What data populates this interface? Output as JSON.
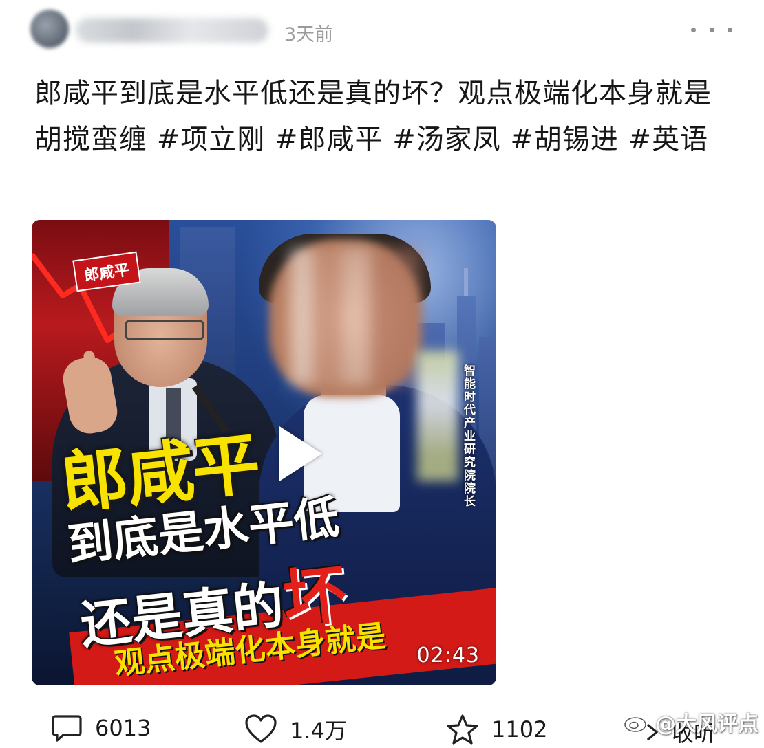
{
  "header": {
    "author_name": "",
    "time_ago": "3天前",
    "more_icon": "more-dots-icon"
  },
  "post": {
    "text_plain": "郎咸平到底是水平低还是真的坏？观点极端化本身就是胡搅蛮缠",
    "hashtags": [
      "#项立刚",
      "#郎咸平",
      "#汤家凤",
      "#胡锡进",
      "#英语"
    ]
  },
  "video": {
    "name_tag": "郎咸平",
    "headline_1": "郎咸平",
    "headline_2": "到底是水平低",
    "headline_3_prefix": "还是真的",
    "headline_3_accent": "坏",
    "headline_4": "观点极端化本身就是",
    "side_caption": "智能时代产业研究院院长",
    "duration": "02:43",
    "colors": {
      "headline_yellow": "#f7e200",
      "accent_red": "#e3211b",
      "banner_red": "#d31a16"
    }
  },
  "actions": {
    "comment": {
      "icon": "comment-icon",
      "count": "6013"
    },
    "like": {
      "icon": "heart-icon",
      "count": "1.4万"
    },
    "favorite": {
      "icon": "star-icon",
      "count": "1102"
    },
    "collapse": {
      "icon": "collapse-icon",
      "label": "收听"
    }
  },
  "watermark": {
    "icon": "weibo-logo-icon",
    "text": "@大风评点"
  }
}
